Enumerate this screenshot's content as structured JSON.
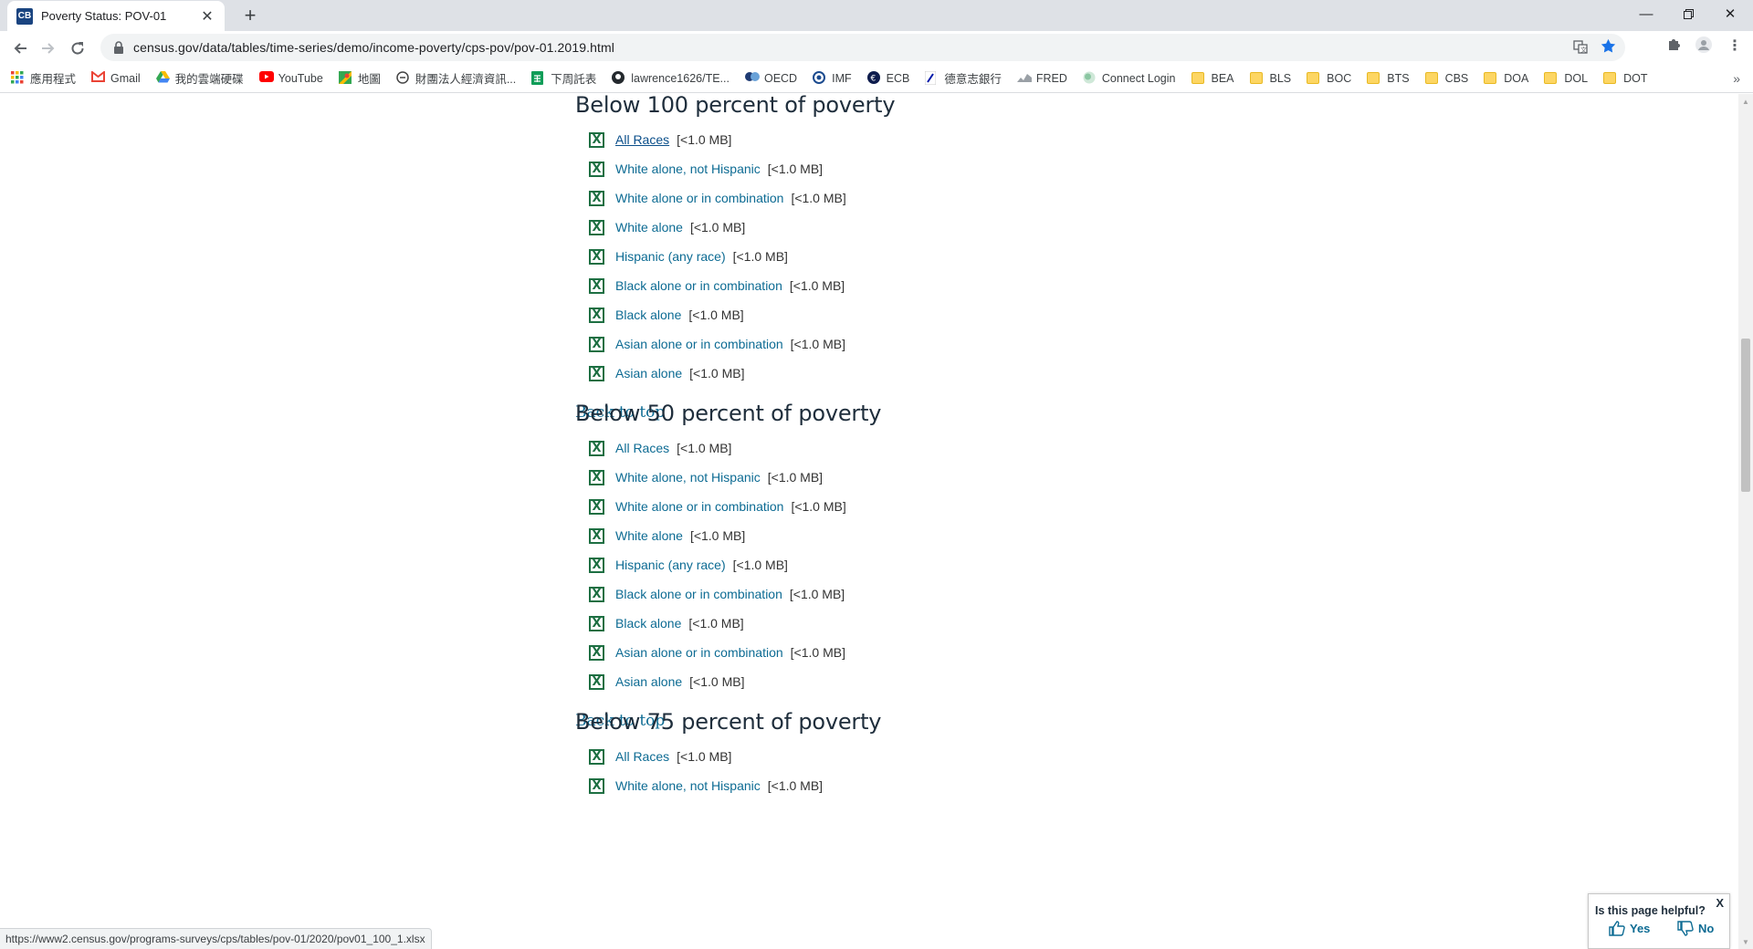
{
  "browser": {
    "tab_title": "Poverty Status: POV-01",
    "tab_favicon_text": "CB",
    "url": "census.gov/data/tables/time-series/demo/income-poverty/cps-pov/pov-01.2019.html",
    "bookmarks": [
      {
        "label": "應用程式",
        "icon": "apps-grid-icon"
      },
      {
        "label": "Gmail",
        "icon": "gmail-icon"
      },
      {
        "label": "我的雲端硬碟",
        "icon": "drive-icon"
      },
      {
        "label": "YouTube",
        "icon": "youtube-icon"
      },
      {
        "label": "地圖",
        "icon": "maps-icon"
      },
      {
        "label": "財團法人經濟資訊...",
        "icon": "globe-icon"
      },
      {
        "label": "下周託表",
        "icon": "sheets-icon"
      },
      {
        "label": "lawrence1626/TE...",
        "icon": "github-icon"
      },
      {
        "label": "OECD",
        "icon": "oecd-icon"
      },
      {
        "label": "IMF",
        "icon": "imf-icon"
      },
      {
        "label": "ECB",
        "icon": "ecb-icon"
      },
      {
        "label": "德意志銀行",
        "icon": "bank-icon"
      },
      {
        "label": "FRED",
        "icon": "chart-icon"
      },
      {
        "label": "Connect Login",
        "icon": "connect-icon"
      },
      {
        "label": "BEA",
        "icon": "folder-icon"
      },
      {
        "label": "BLS",
        "icon": "folder-icon"
      },
      {
        "label": "BOC",
        "icon": "folder-icon"
      },
      {
        "label": "BTS",
        "icon": "folder-icon"
      },
      {
        "label": "CBS",
        "icon": "folder-icon"
      },
      {
        "label": "DOA",
        "icon": "folder-icon"
      },
      {
        "label": "DOL",
        "icon": "folder-icon"
      },
      {
        "label": "DOT",
        "icon": "folder-icon"
      }
    ],
    "status_url": "https://www2.census.gov/programs-surveys/cps/tables/pov-01/2020/pov01_100_1.xlsx"
  },
  "sections": [
    {
      "heading": "Below 100 percent of poverty",
      "back_to_top": "Back to top",
      "files": [
        {
          "label": "All Races",
          "size": "[<1.0 MB]"
        },
        {
          "label": "White alone, not Hispanic",
          "size": "[<1.0 MB]"
        },
        {
          "label": "White alone or in combination",
          "size": "[<1.0 MB]"
        },
        {
          "label": "White alone",
          "size": "[<1.0 MB]"
        },
        {
          "label": "Hispanic (any race)",
          "size": "[<1.0 MB]"
        },
        {
          "label": "Black alone or in combination",
          "size": "[<1.0 MB]"
        },
        {
          "label": "Black alone",
          "size": "[<1.0 MB]"
        },
        {
          "label": "Asian alone or in combination",
          "size": "[<1.0 MB]"
        },
        {
          "label": "Asian alone",
          "size": "[<1.0 MB]"
        }
      ]
    },
    {
      "heading": "Below 50 percent of poverty",
      "back_to_top": "Back to top",
      "files": [
        {
          "label": "All Races",
          "size": "[<1.0 MB]"
        },
        {
          "label": "White alone, not Hispanic",
          "size": "[<1.0 MB]"
        },
        {
          "label": "White alone or in combination",
          "size": "[<1.0 MB]"
        },
        {
          "label": "White alone",
          "size": "[<1.0 MB]"
        },
        {
          "label": "Hispanic (any race)",
          "size": "[<1.0 MB]"
        },
        {
          "label": "Black alone or in combination",
          "size": "[<1.0 MB]"
        },
        {
          "label": "Black alone",
          "size": "[<1.0 MB]"
        },
        {
          "label": "Asian alone or in combination",
          "size": "[<1.0 MB]"
        },
        {
          "label": "Asian alone",
          "size": "[<1.0 MB]"
        }
      ]
    },
    {
      "heading": "Below 75 percent of poverty",
      "files": [
        {
          "label": "All Races",
          "size": "[<1.0 MB]"
        },
        {
          "label": "White alone, not Hispanic",
          "size": "[<1.0 MB]"
        }
      ]
    }
  ],
  "feedback": {
    "question": "Is this page helpful?",
    "yes": "Yes",
    "no": "No",
    "close": "X"
  },
  "colors": {
    "link": "#0d6b93",
    "heading": "#1f2e3c",
    "excel_green": "#1d6f42"
  }
}
